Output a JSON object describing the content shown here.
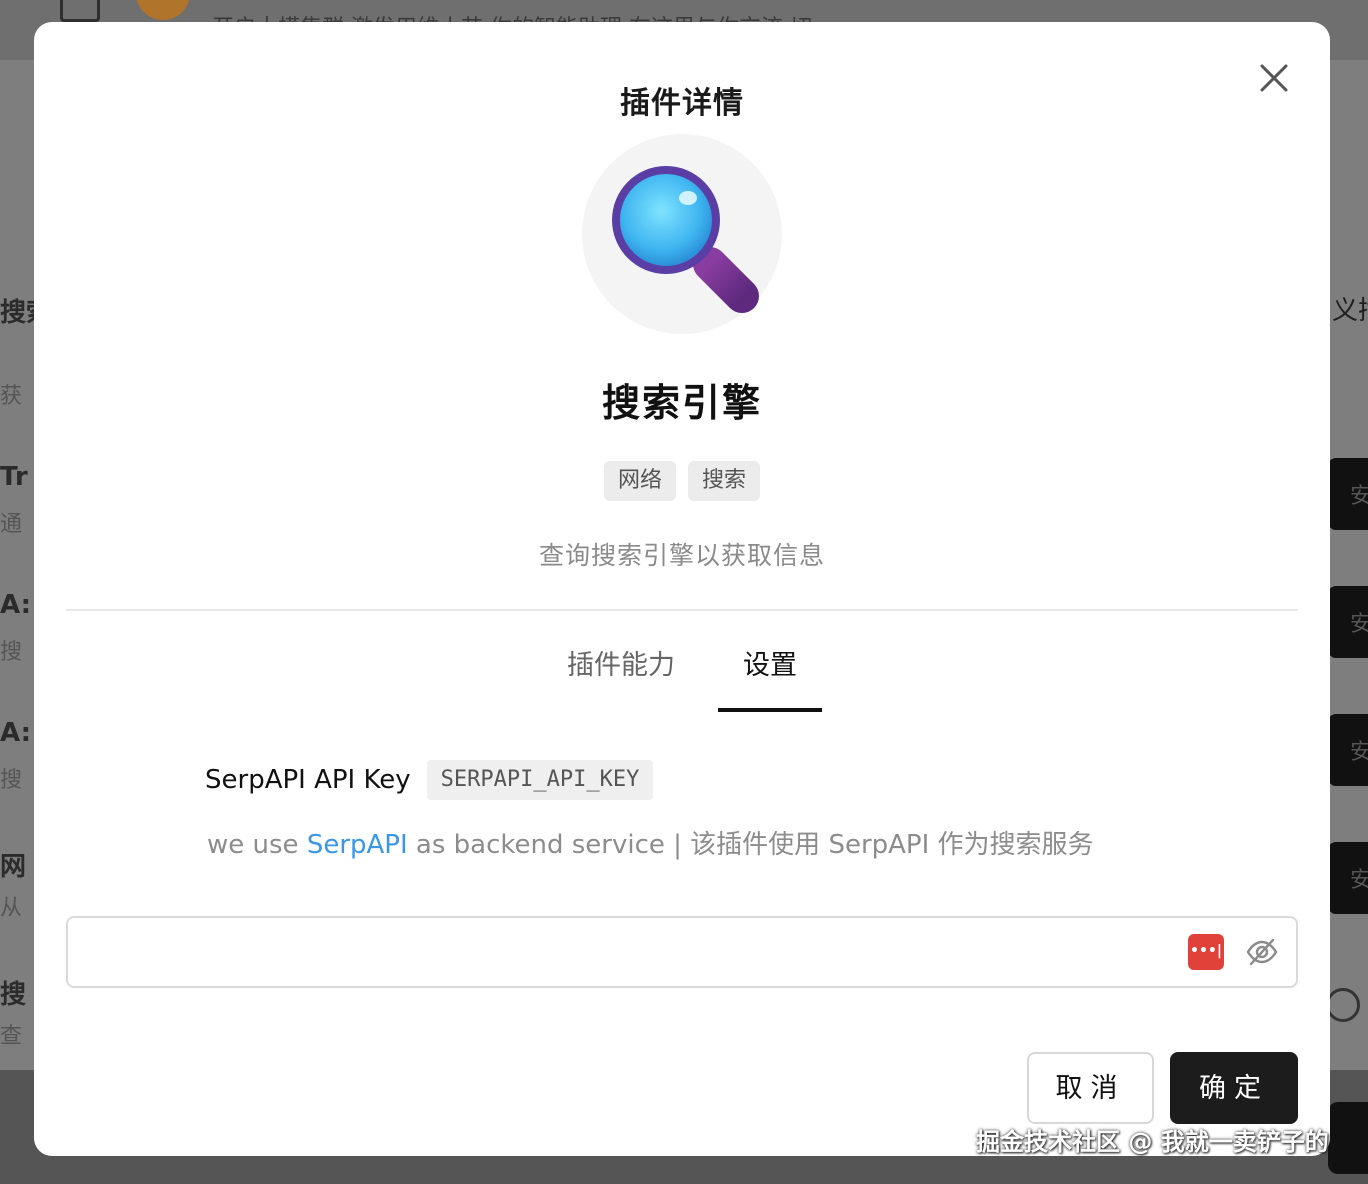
{
  "background": {
    "topbar_text": "开启大模集群  激发用维小芯  你的智能助理  在这里与你交流  切",
    "left_rows": [
      {
        "text": "搜索",
        "kind": "heading"
      },
      {
        "text": "获",
        "kind": "sub"
      },
      {
        "text": "Tr",
        "kind": "heading"
      },
      {
        "text": "通",
        "kind": "sub"
      },
      {
        "text": "A:",
        "kind": "heading"
      },
      {
        "text": "搜",
        "kind": "sub"
      },
      {
        "text": "A:",
        "kind": "heading"
      },
      {
        "text": "搜",
        "kind": "sub"
      },
      {
        "text": "网",
        "kind": "heading"
      },
      {
        "text": "从",
        "kind": "sub"
      },
      {
        "text": "搜",
        "kind": "heading"
      },
      {
        "text": "查",
        "kind": "sub"
      }
    ],
    "right_text": "义插",
    "right_buttons": [
      "安",
      "安",
      "安",
      "安"
    ]
  },
  "modal": {
    "title": "插件详情",
    "plugin": {
      "name": "搜索引擎",
      "tags": [
        "网络",
        "搜索"
      ],
      "description": "查询搜索引擎以获取信息"
    },
    "tabs": [
      {
        "label": "插件能力",
        "active": false
      },
      {
        "label": "设置",
        "active": true
      }
    ],
    "setting": {
      "label": "SerpAPI API Key",
      "env_var": "SERPAPI_API_KEY",
      "desc_prefix": "we use ",
      "desc_link": "SerpAPI",
      "desc_suffix": " as backend service | 该插件使用 SerpAPI 作为搜索服务",
      "input_value": "",
      "password_manager_icon_text": "•••|"
    },
    "buttons": {
      "cancel": "取消",
      "ok": "确定"
    }
  },
  "watermark": "掘金技术社区 @ 我就一卖铲子的",
  "colors": {
    "link": "#3a97e8",
    "primary_button": "#1c1c1c",
    "password_manager": "#e0423a"
  }
}
